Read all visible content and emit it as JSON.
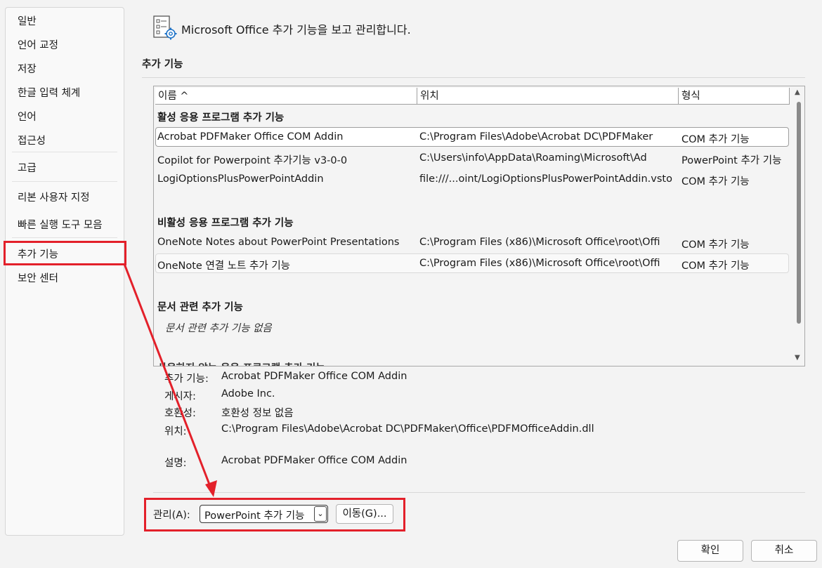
{
  "sidebar": {
    "items": [
      {
        "label": "일반"
      },
      {
        "label": "언어 교정"
      },
      {
        "label": "저장"
      },
      {
        "label": "한글 입력 체계"
      },
      {
        "label": "언어"
      },
      {
        "label": "접근성"
      },
      {
        "label": "고급"
      },
      {
        "label": "리본 사용자 지정"
      },
      {
        "label": "빠른 실행 도구 모음"
      },
      {
        "label": "추가 기능"
      },
      {
        "label": "보안 센터"
      }
    ],
    "selected": "추가 기능"
  },
  "header": {
    "title": "Microsoft Office 추가 기능을 보고 관리합니다.",
    "icon": "addins-settings-icon"
  },
  "section_title": "추가 기능",
  "list": {
    "columns": [
      "이름 ^",
      "위치",
      "형식"
    ],
    "groups": [
      {
        "title": "활성 응용 프로그램 추가 기능",
        "rows": [
          {
            "name": "Acrobat PDFMaker Office COM Addin",
            "location": "C:\\Program Files\\Adobe\\Acrobat DC\\PDFMaker",
            "type": "COM 추가 기능"
          },
          {
            "name": "Copilot for Powerpoint 추가기능 v3-0-0",
            "location": "C:\\Users\\info\\AppData\\Roaming\\Microsoft\\Ad",
            "type": "PowerPoint 추가 기능"
          },
          {
            "name": "LogiOptionsPlusPowerPointAddin",
            "location": "file:///...oint/LogiOptionsPlusPowerPointAddin.vsto",
            "type": "COM 추가 기능"
          }
        ]
      },
      {
        "title": "비활성 응용 프로그램 추가 기능",
        "rows": [
          {
            "name": "OneNote Notes about PowerPoint Presentations",
            "location": "C:\\Program Files (x86)\\Microsoft Office\\root\\Offi",
            "type": "COM 추가 기능"
          },
          {
            "name": "OneNote 연결 노트 추가 기능",
            "location": "C:\\Program Files (x86)\\Microsoft Office\\root\\Offi",
            "type": "COM 추가 기능"
          }
        ]
      },
      {
        "title": "문서 관련 추가 기능",
        "empty_text": "문서 관련 추가 기능 없음"
      }
    ],
    "partial_group_title": "사용하지 않는 응용 프로그램 추가 기능"
  },
  "details": {
    "addin_label": "추가 기능:",
    "addin_value": "Acrobat PDFMaker Office COM Addin",
    "publisher_label": "게시자:",
    "publisher_value": "Adobe Inc.",
    "compat_label": "호환성:",
    "compat_value": "호환성 정보 없음",
    "location_label": "위치:",
    "location_value": "C:\\Program Files\\Adobe\\Acrobat DC\\PDFMaker\\Office\\PDFMOfficeAddin.dll",
    "desc_label": "설명:",
    "desc_value": "Acrobat PDFMaker Office COM Addin"
  },
  "manage": {
    "label": "관리(A):",
    "selected": "PowerPoint 추가 기능",
    "go_button": "이동(G)..."
  },
  "footer": {
    "ok": "확인",
    "cancel": "취소"
  },
  "colors": {
    "annotation_red": "#e3202a"
  }
}
